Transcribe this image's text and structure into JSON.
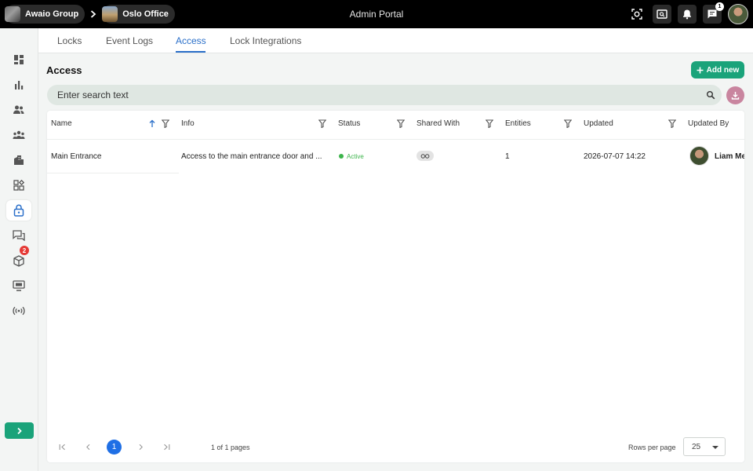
{
  "header": {
    "breadcrumb": [
      {
        "label": "Awaio Group"
      },
      {
        "label": "Oslo Office"
      }
    ],
    "title": "Admin Portal",
    "chat_badge": "1"
  },
  "sidebar": {
    "items": [
      {
        "name": "dashboard"
      },
      {
        "name": "analytics"
      },
      {
        "name": "people"
      },
      {
        "name": "groups"
      },
      {
        "name": "buildings"
      },
      {
        "name": "apps"
      },
      {
        "name": "locks",
        "active": true
      },
      {
        "name": "chat"
      },
      {
        "name": "packages",
        "badge": "2"
      },
      {
        "name": "displays"
      },
      {
        "name": "broadcast"
      }
    ]
  },
  "tabs": [
    {
      "label": "Locks"
    },
    {
      "label": "Event Logs"
    },
    {
      "label": "Access",
      "active": true
    },
    {
      "label": "Lock Integrations"
    }
  ],
  "main": {
    "title": "Access",
    "add_label": "Add new",
    "search_placeholder": "Enter search text"
  },
  "table": {
    "columns": [
      "Name",
      "Info",
      "Status",
      "Shared With",
      "Entities",
      "Updated",
      "Updated By"
    ],
    "rows": [
      {
        "name": "Main Entrance",
        "info": "Access to the main entrance door and ...",
        "status": "Active",
        "entities": "1",
        "updated": "2026-07-07 14:22",
        "updated_by": "Liam Me"
      }
    ]
  },
  "pagination": {
    "current_page": "1",
    "info": "1 of 1 pages",
    "rows_per_page_label": "Rows per page",
    "rows_per_page": "25"
  },
  "colors": {
    "accent_green": "#1aa37a",
    "accent_blue": "#2a6fc9",
    "download_pink": "#c9859f",
    "active_status": "#3cb44b"
  }
}
